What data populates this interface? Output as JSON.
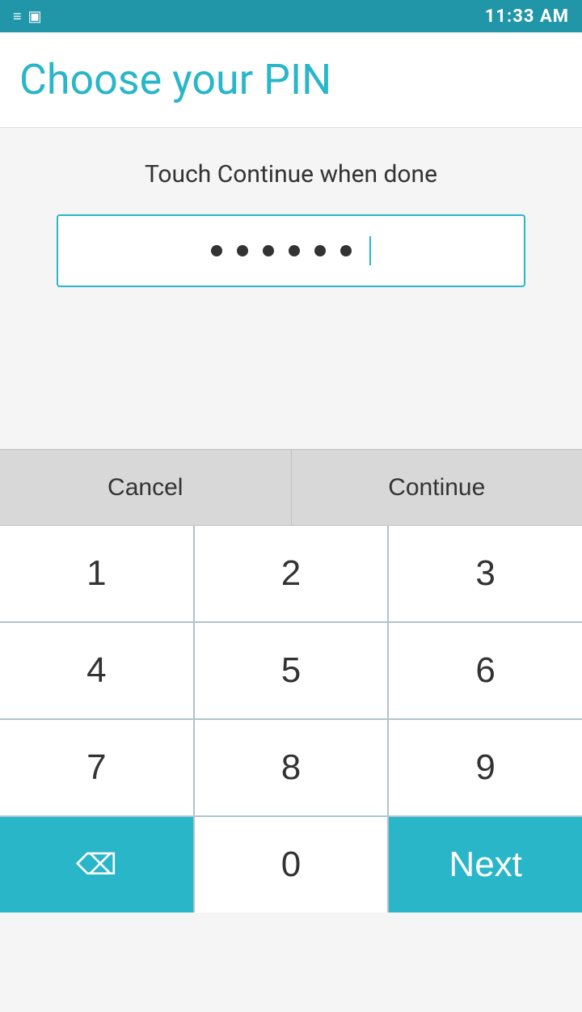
{
  "statusBar": {
    "time": "11:33 AM"
  },
  "header": {
    "title": "Choose your PIN"
  },
  "main": {
    "instruction": "Touch Continue when done",
    "pinDotsCount": 6
  },
  "actionButtons": {
    "cancel": "Cancel",
    "continue": "Continue"
  },
  "numpad": {
    "keys": [
      "1",
      "2",
      "3",
      "4",
      "5",
      "6",
      "7",
      "8",
      "9",
      "backspace",
      "0",
      "next"
    ],
    "next_label": "Next"
  }
}
